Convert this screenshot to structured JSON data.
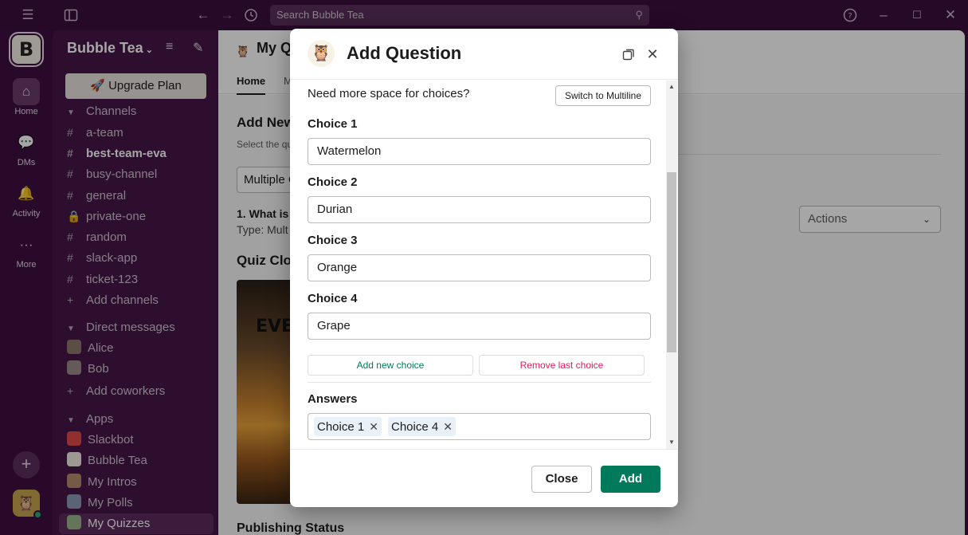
{
  "topbar": {
    "search_placeholder": "Search Bubble Tea"
  },
  "rail": {
    "workspace_initial": "B",
    "items": [
      {
        "label": "Home",
        "icon": "home-icon"
      },
      {
        "label": "DMs",
        "icon": "dms-icon"
      },
      {
        "label": "Activity",
        "icon": "bell-icon"
      },
      {
        "label": "More",
        "icon": "more-icon"
      }
    ]
  },
  "sidebar": {
    "workspace_name": "Bubble Tea",
    "upgrade_label": "Upgrade Plan",
    "channels_header": "Channels",
    "channels": [
      "a-team",
      "best-team-eva",
      "busy-channel",
      "general",
      "private-one",
      "random",
      "slack-app",
      "ticket-123"
    ],
    "bold_channel": "best-team-eva",
    "add_channels": "Add channels",
    "dms_header": "Direct messages",
    "dms": [
      "Alice",
      "Bob"
    ],
    "add_coworkers": "Add coworkers",
    "apps_header": "Apps",
    "apps": [
      "Slackbot",
      "Bubble Tea",
      "My Intros",
      "My Polls",
      "My Quizzes"
    ]
  },
  "main": {
    "title": "My Q",
    "tabs": [
      "Home",
      "M"
    ],
    "heading": "Add New",
    "subtext": "Select the qu",
    "select_value": "Multiple C",
    "question_line": "1. What is",
    "type_line": "Type: Mult",
    "quiz_heading": "Quiz Clos",
    "poster_text": "EVE",
    "actions_label": "Actions",
    "publishing_heading": "Publishing Status"
  },
  "modal": {
    "title": "Add Question",
    "more_space_text": "Need more space for choices?",
    "switch_label": "Switch to Multiline",
    "choices": [
      {
        "label": "Choice 1",
        "value": "Watermelon"
      },
      {
        "label": "Choice 2",
        "value": "Durian"
      },
      {
        "label": "Choice 3",
        "value": "Orange"
      },
      {
        "label": "Choice 4",
        "value": "Grape"
      }
    ],
    "add_choice_label": "Add new choice",
    "remove_choice_label": "Remove last choice",
    "answers_label": "Answers",
    "answers": [
      "Choice 1",
      "Choice 4"
    ],
    "close_label": "Close",
    "add_label": "Add"
  },
  "colors": {
    "aubergine": "#3f0e40",
    "sidebar": "#481649",
    "primary_green": "#007a5a",
    "danger": "#e01e5a"
  }
}
